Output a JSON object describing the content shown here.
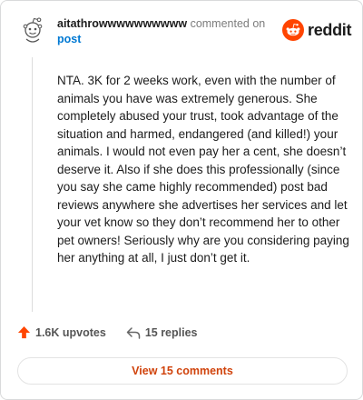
{
  "header": {
    "username": "aitathrowwwwwwwwww",
    "commented_text": "commented on",
    "post_link": "post",
    "brand": "reddit"
  },
  "comment": {
    "body": "NTA. 3K for 2 weeks work, even with the number of animals you have was extremely generous. She completely abused your trust, took advantage of the situation and harmed, endangered (and killed!) your animals. I would not even pay her a cent, she doesn’t deserve it. Also if she does this professionally (since you say she came highly recommended) post bad reviews anywhere she advertises her services and let your vet know so they don’t recommend her to other pet owners! Seriously why are you considering paying her anything at all, I just don’t get it."
  },
  "actions": {
    "upvotes": "1.6K upvotes",
    "replies": "15 replies"
  },
  "footer": {
    "view_comments": "View 15 comments"
  },
  "icons": {
    "avatar": "snoo-avatar-icon",
    "brand": "reddit-logo-icon",
    "upvote": "upvote-arrow-icon",
    "reply": "reply-arrow-icon"
  },
  "colors": {
    "brand_orange": "#ff4500",
    "upvote_orange": "#ff4500",
    "link_blue": "#0079d3",
    "button_text": "#d0430c"
  }
}
